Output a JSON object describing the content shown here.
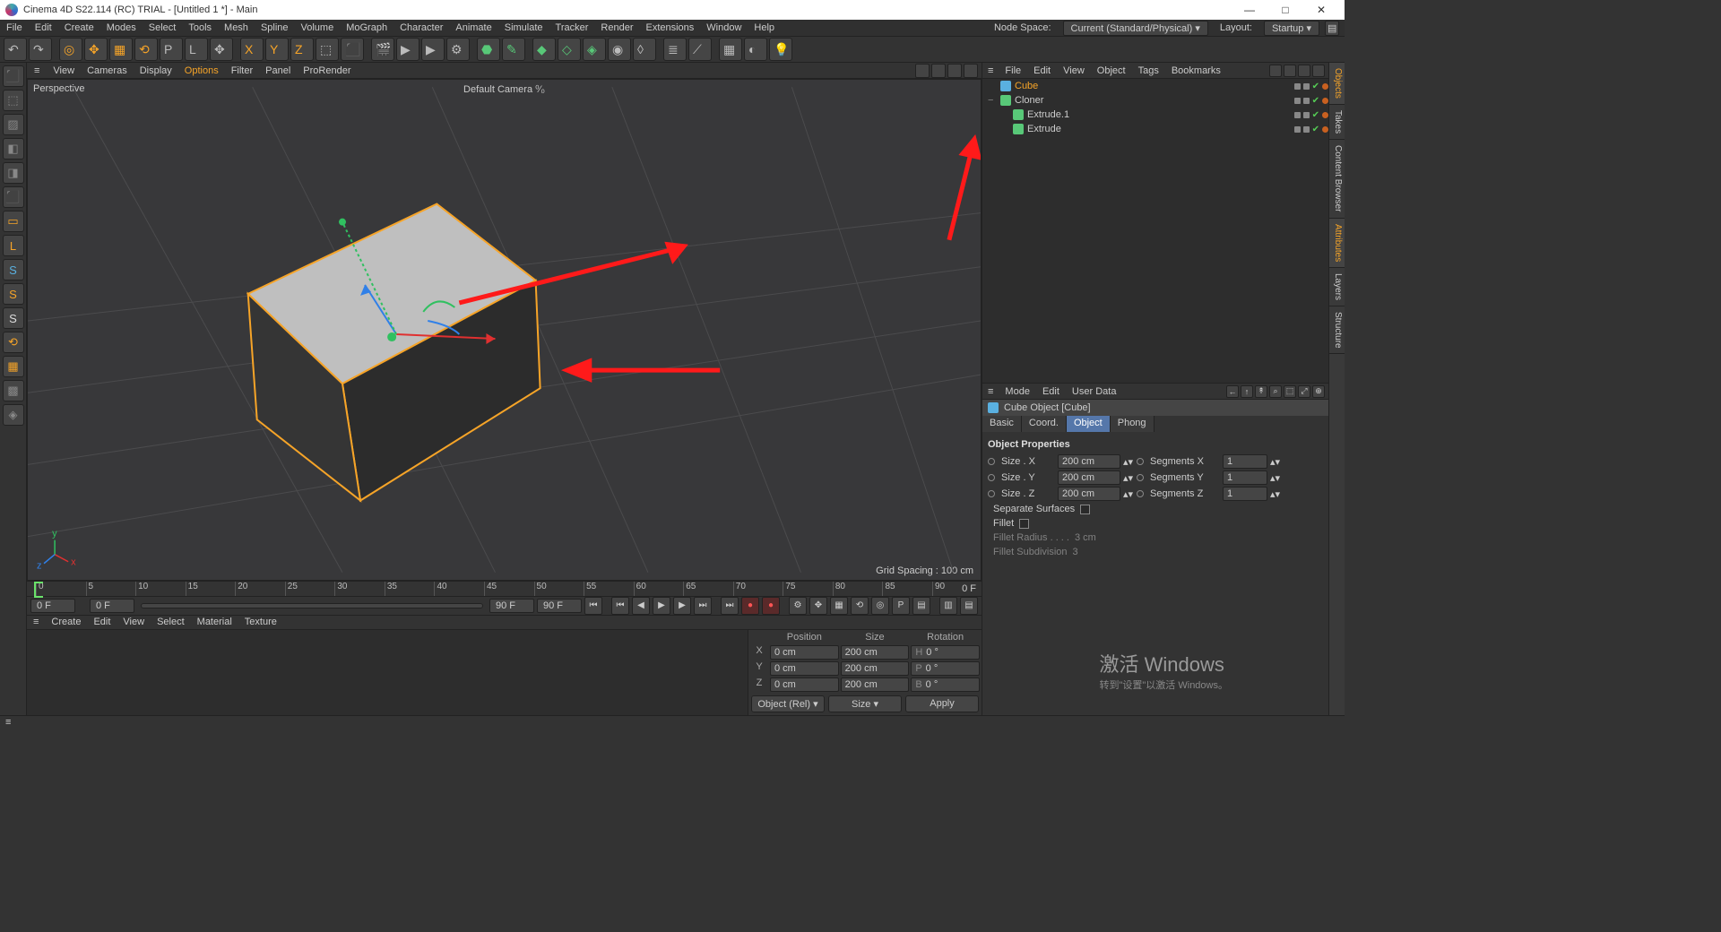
{
  "window": {
    "title": "Cinema 4D S22.114 (RC) TRIAL - [Untitled 1 *] - Main",
    "min": "—",
    "max": "□",
    "close": "✕"
  },
  "menubar": {
    "items": [
      "File",
      "Edit",
      "Create",
      "Modes",
      "Select",
      "Tools",
      "Mesh",
      "Spline",
      "Volume",
      "MoGraph",
      "Character",
      "Animate",
      "Simulate",
      "Tracker",
      "Render",
      "Extensions",
      "Window",
      "Help"
    ],
    "nodespace_label": "Node Space:",
    "nodespace_value": "Current (Standard/Physical)",
    "layout_label": "Layout:",
    "layout_value": "Startup"
  },
  "viewport_menu": {
    "items": [
      "View",
      "Cameras",
      "Display",
      "Options",
      "Filter",
      "Panel",
      "ProRender"
    ],
    "active": "Options"
  },
  "viewport": {
    "mode": "Perspective",
    "camera": "Default Camera ⁰⁄₀",
    "grid": "Grid Spacing : 100 cm"
  },
  "timeline": {
    "start": "0 F",
    "end": "90 F",
    "cur": "0 F",
    "ticks": [
      0,
      5,
      10,
      15,
      20,
      25,
      30,
      35,
      40,
      45,
      50,
      55,
      60,
      65,
      70,
      75,
      80,
      85,
      90
    ],
    "right": "0 F"
  },
  "materials_menu": {
    "items": [
      "Create",
      "Edit",
      "View",
      "Select",
      "Material",
      "Texture"
    ]
  },
  "coord": {
    "hdr": [
      "",
      "Position",
      "Size",
      "Rotation"
    ],
    "rows": [
      {
        "a": "X",
        "p": "0 cm",
        "s": "200 cm",
        "rl": "H",
        "r": "0 °"
      },
      {
        "a": "Y",
        "p": "0 cm",
        "s": "200 cm",
        "rl": "P",
        "r": "0 °"
      },
      {
        "a": "Z",
        "p": "0 cm",
        "s": "200 cm",
        "rl": "B",
        "r": "0 °"
      }
    ],
    "mode1": "Object (Rel)",
    "mode2": "Size",
    "apply": "Apply"
  },
  "obj_menu": {
    "items": [
      "File",
      "Edit",
      "View",
      "Object",
      "Tags",
      "Bookmarks"
    ]
  },
  "objects": [
    {
      "name": "Cube",
      "sel": true,
      "color": "#5ab0e0",
      "indent": 0
    },
    {
      "name": "Cloner",
      "sel": false,
      "color": "#58c878",
      "indent": 0,
      "exp": "−"
    },
    {
      "name": "Extrude.1",
      "sel": false,
      "color": "#58c878",
      "indent": 1
    },
    {
      "name": "Extrude",
      "sel": false,
      "color": "#58c878",
      "indent": 1
    }
  ],
  "attr_menu": {
    "items": [
      "Mode",
      "Edit",
      "User Data"
    ]
  },
  "attr_header": "Cube Object [Cube]",
  "attr_tabs": [
    "Basic",
    "Coord.",
    "Object",
    "Phong"
  ],
  "attr_tab_active": "Object",
  "attr_section": "Object Properties",
  "attr_props": [
    {
      "l": "Size . X",
      "v": "200 cm",
      "l2": "Segments X",
      "v2": "1"
    },
    {
      "l": "Size . Y",
      "v": "200 cm",
      "l2": "Segments Y",
      "v2": "1"
    },
    {
      "l": "Size . Z",
      "v": "200 cm",
      "l2": "Segments Z",
      "v2": "1"
    }
  ],
  "attr_checks": [
    {
      "l": "Separate Surfaces",
      "c": false
    },
    {
      "l": "Fillet",
      "c": false
    }
  ],
  "attr_dim": [
    {
      "l": "Fillet Radius . . . .",
      "v": "3 cm"
    },
    {
      "l": "Fillet Subdivision",
      "v": "3"
    }
  ],
  "sidetabs": [
    "Objects",
    "Takes",
    "Content Browser",
    "Attributes",
    "Layers",
    "Structure"
  ],
  "watermark": {
    "big": "激活 Windows",
    "sm": "转到\"设置\"以激活 Windows。"
  }
}
